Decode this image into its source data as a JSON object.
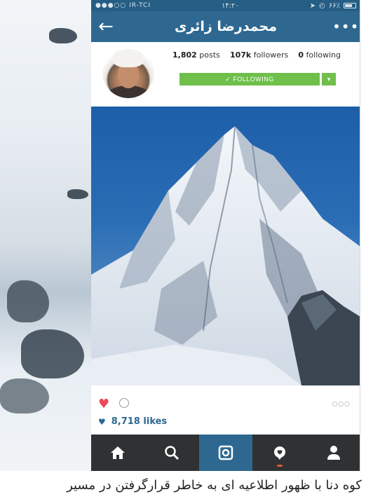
{
  "status_bar": {
    "carrier": "●●●○○ IR-TCI",
    "time": "۱۴:۲۰",
    "battery": "۶۶٪"
  },
  "nav": {
    "profile_name": "محمدرضا زائری",
    "back_icon": "back-arrow-icon",
    "more_icon": "more-dots-icon"
  },
  "profile": {
    "posts_value": "1,802",
    "posts_label": "posts",
    "followers_value": "107k",
    "followers_label": "followers",
    "following_value": "0",
    "following_label": "following",
    "following_button": "✓ FOLLOWING",
    "dropdown": "▾"
  },
  "post": {
    "likes": "8,718 likes"
  },
  "tabs": [
    {
      "icon": "home-icon"
    },
    {
      "icon": "search-icon"
    },
    {
      "icon": "camera-icon"
    },
    {
      "icon": "activity-icon"
    },
    {
      "icon": "profile-icon"
    }
  ],
  "caption": "کوه دنا با ظهور اطلاعیه ای به خاطر قرارگرفتن در مسیر",
  "colors": {
    "nav_blue": "#2e6891",
    "status_blue": "#255d84",
    "follow_green": "#6fbf4b",
    "heart_red": "#ed4956",
    "tabbar_dark": "#2f3133"
  }
}
